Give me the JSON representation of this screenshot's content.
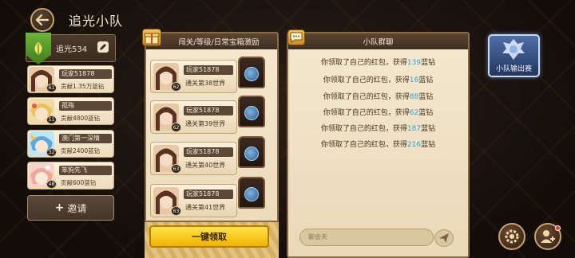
{
  "header": {
    "title": "追光小队"
  },
  "leader": {
    "name": "追光534"
  },
  "members": [
    {
      "name": "玩家51878",
      "contribution": "贡献1.35万蓝钻",
      "level": "61"
    },
    {
      "name": "孤殇",
      "contribution": "贡献4800蓝钻",
      "level": "51"
    },
    {
      "name": "澳门第一深情",
      "contribution": "贡献2400蓝钻",
      "level": "32"
    },
    {
      "name": "笨狗先飞",
      "contribution": "贡献600蓝钻",
      "level": "48"
    }
  ],
  "invite_label": "邀请",
  "rewards_panel": {
    "title": "闯关/等级/日常宝箱激励",
    "rows": [
      {
        "name": "玩家51878",
        "stage": "通关第38世界",
        "level": "62"
      },
      {
        "name": "玩家51878",
        "stage": "通关第39世界",
        "level": "62"
      },
      {
        "name": "玩家51878",
        "stage": "通关第40世界",
        "level": "63"
      },
      {
        "name": "玩家51878",
        "stage": "通关第41世界",
        "level": "63"
      }
    ],
    "claim_all_label": "一键领取"
  },
  "chat_panel": {
    "title": "小队群聊",
    "messages": [
      {
        "text": "你领取了自己的红包，获得",
        "amount": "139",
        "unit": "蓝钻"
      },
      {
        "text": "你领取了自己的红包，获得",
        "amount": "16",
        "unit": "蓝钻"
      },
      {
        "text": "你领取了自己的红包，获得",
        "amount": "88",
        "unit": "蓝钻"
      },
      {
        "text": "你领取了自己的红包，获得",
        "amount": "62",
        "unit": "蓝钻"
      },
      {
        "text": "你领取了自己的红包，获得",
        "amount": "187",
        "unit": "蓝钻"
      },
      {
        "text": "你领取了自己的红包，获得",
        "amount": "216",
        "unit": "蓝钻"
      }
    ],
    "input_placeholder": "聊会天"
  },
  "event": {
    "label": "小队输出赛"
  },
  "icons": {
    "back": "back-arrow-icon",
    "settings": "gear-icon",
    "add_friend": "add-user-icon",
    "send": "paper-plane-icon",
    "gift": "gift-icon",
    "chat": "chat-bubble-icon"
  },
  "colors": {
    "accent_number": "#2aa5d9",
    "claim_button": "#f7c81f"
  }
}
